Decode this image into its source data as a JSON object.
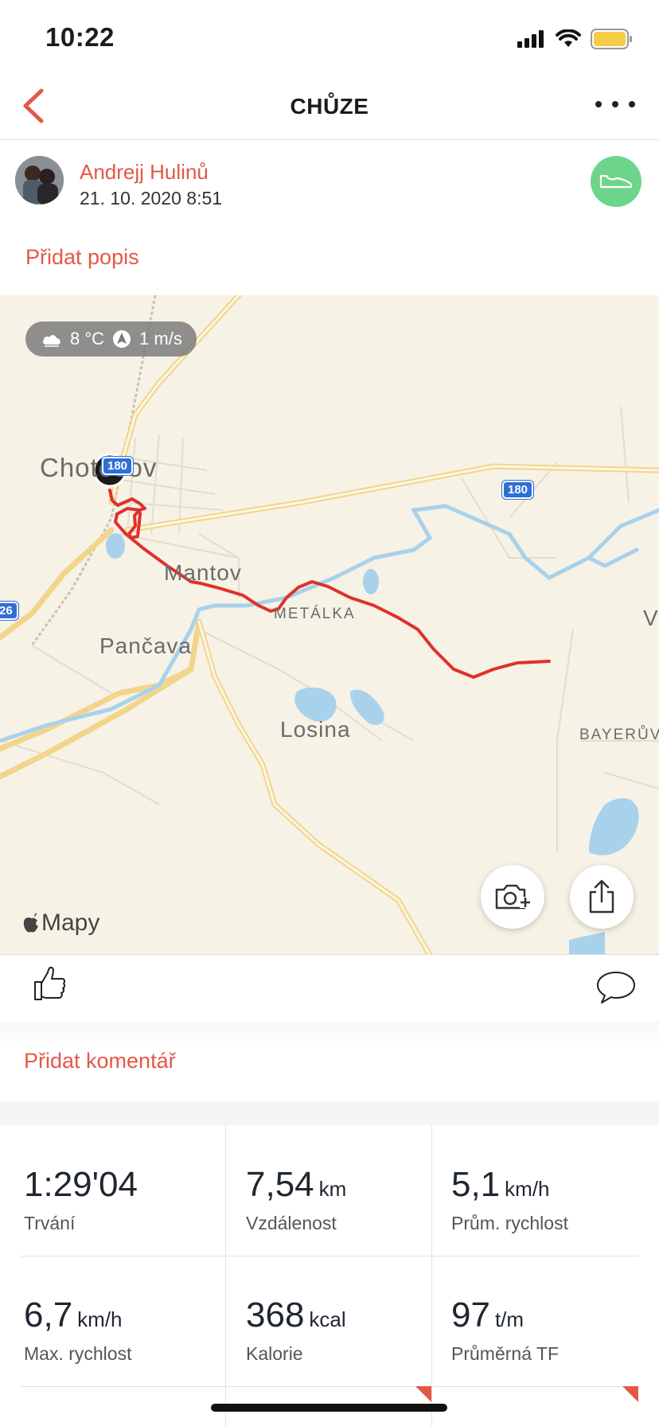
{
  "status_bar": {
    "time": "10:22"
  },
  "nav": {
    "title": "CHŮZE"
  },
  "profile": {
    "name": "Andrejj Hulinů",
    "date": "21. 10. 2020 8:51",
    "activity_icon": "shoe-icon"
  },
  "add_description": "Přidat popis",
  "map": {
    "weather": {
      "temperature": "8 °C",
      "wind": "1 m/s"
    },
    "places": {
      "chotesov": "Chotešov",
      "mantov": "Mantov",
      "pancava": "Pančava",
      "metalka": "METÁLKA",
      "losina": "Losina",
      "bayeruv": "BAYERŮV",
      "v": "V"
    },
    "road_shields": {
      "a": "180",
      "b": "180",
      "c": "26"
    },
    "maps_label": "Mapy",
    "route_color": "#e0302a"
  },
  "add_comment": "Přidat komentář",
  "stats": [
    {
      "value": "1:29'04",
      "unit": "",
      "label": "Trvání"
    },
    {
      "value": "7,54",
      "unit": "km",
      "label": "Vzdálenost"
    },
    {
      "value": "5,1",
      "unit": "km/h",
      "label": "Prům. rychlost"
    },
    {
      "value": "6,7",
      "unit": "km/h",
      "label": "Max. rychlost"
    },
    {
      "value": "368",
      "unit": "kcal",
      "label": "Kalorie"
    },
    {
      "value": "97",
      "unit": "t/m",
      "label": "Průměrná TF"
    }
  ],
  "colors": {
    "accent": "#e35848",
    "badge": "#6dd589"
  }
}
